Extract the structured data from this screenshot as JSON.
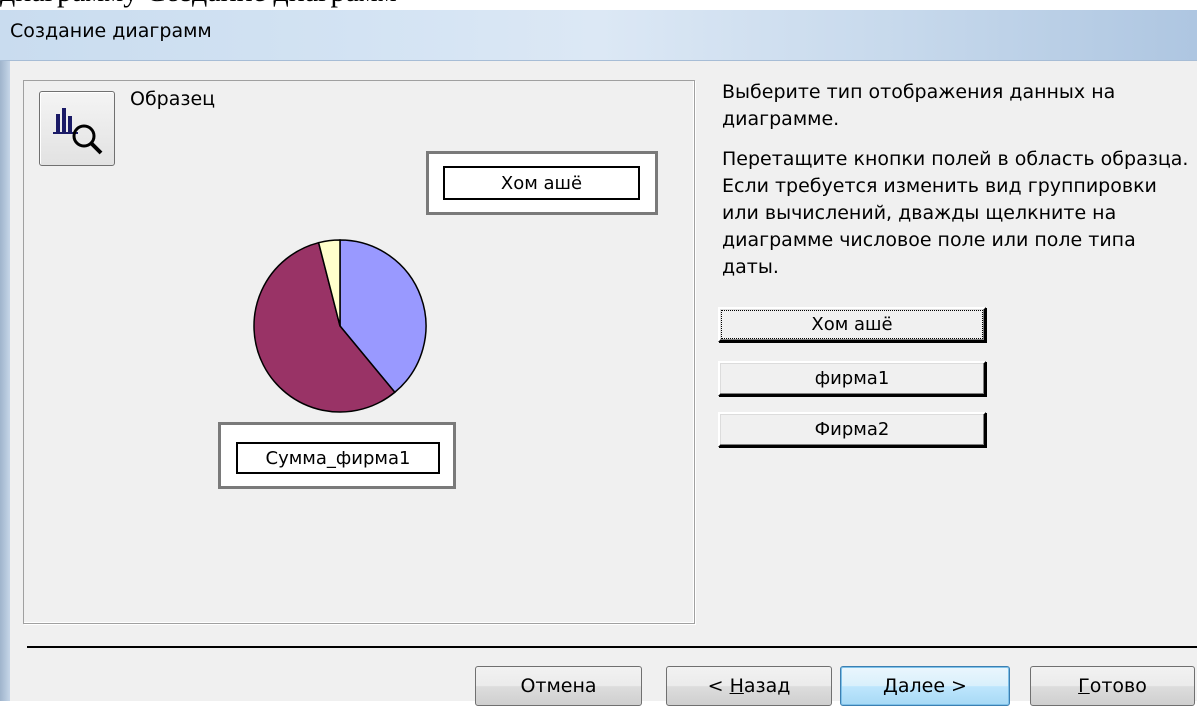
{
  "page_text": "диаграмму Создание диаграмм",
  "window": {
    "title": "Создание диаграмм"
  },
  "sample": {
    "label": "Образец",
    "series_field": "Хом ашё",
    "data_field": "Сумма_фирма1",
    "pie_slices": [
      {
        "value": 39,
        "color": "#9999ff"
      },
      {
        "value": 57,
        "color": "#993366"
      },
      {
        "value": 4,
        "color": "#ffffcc"
      }
    ]
  },
  "instructions": {
    "line1": "Выберите тип отображения данных на диаграмме.",
    "line2": "Перетащите кнопки полей в область образца. Если требуется изменить вид группировки или вычислений, дважды щелкните на диаграмме числовое поле или поле типа даты."
  },
  "fields": [
    {
      "label": "Хом ашё"
    },
    {
      "label": "фирма1"
    },
    {
      "label": "Фирма2"
    }
  ],
  "buttons": {
    "cancel": "Отмена",
    "back_prefix": "< ",
    "back_accel": "Н",
    "back_rest": "азад",
    "next_accel": "Д",
    "next_rest": "алее >",
    "finish_accel": "Г",
    "finish_rest": "отово"
  }
}
